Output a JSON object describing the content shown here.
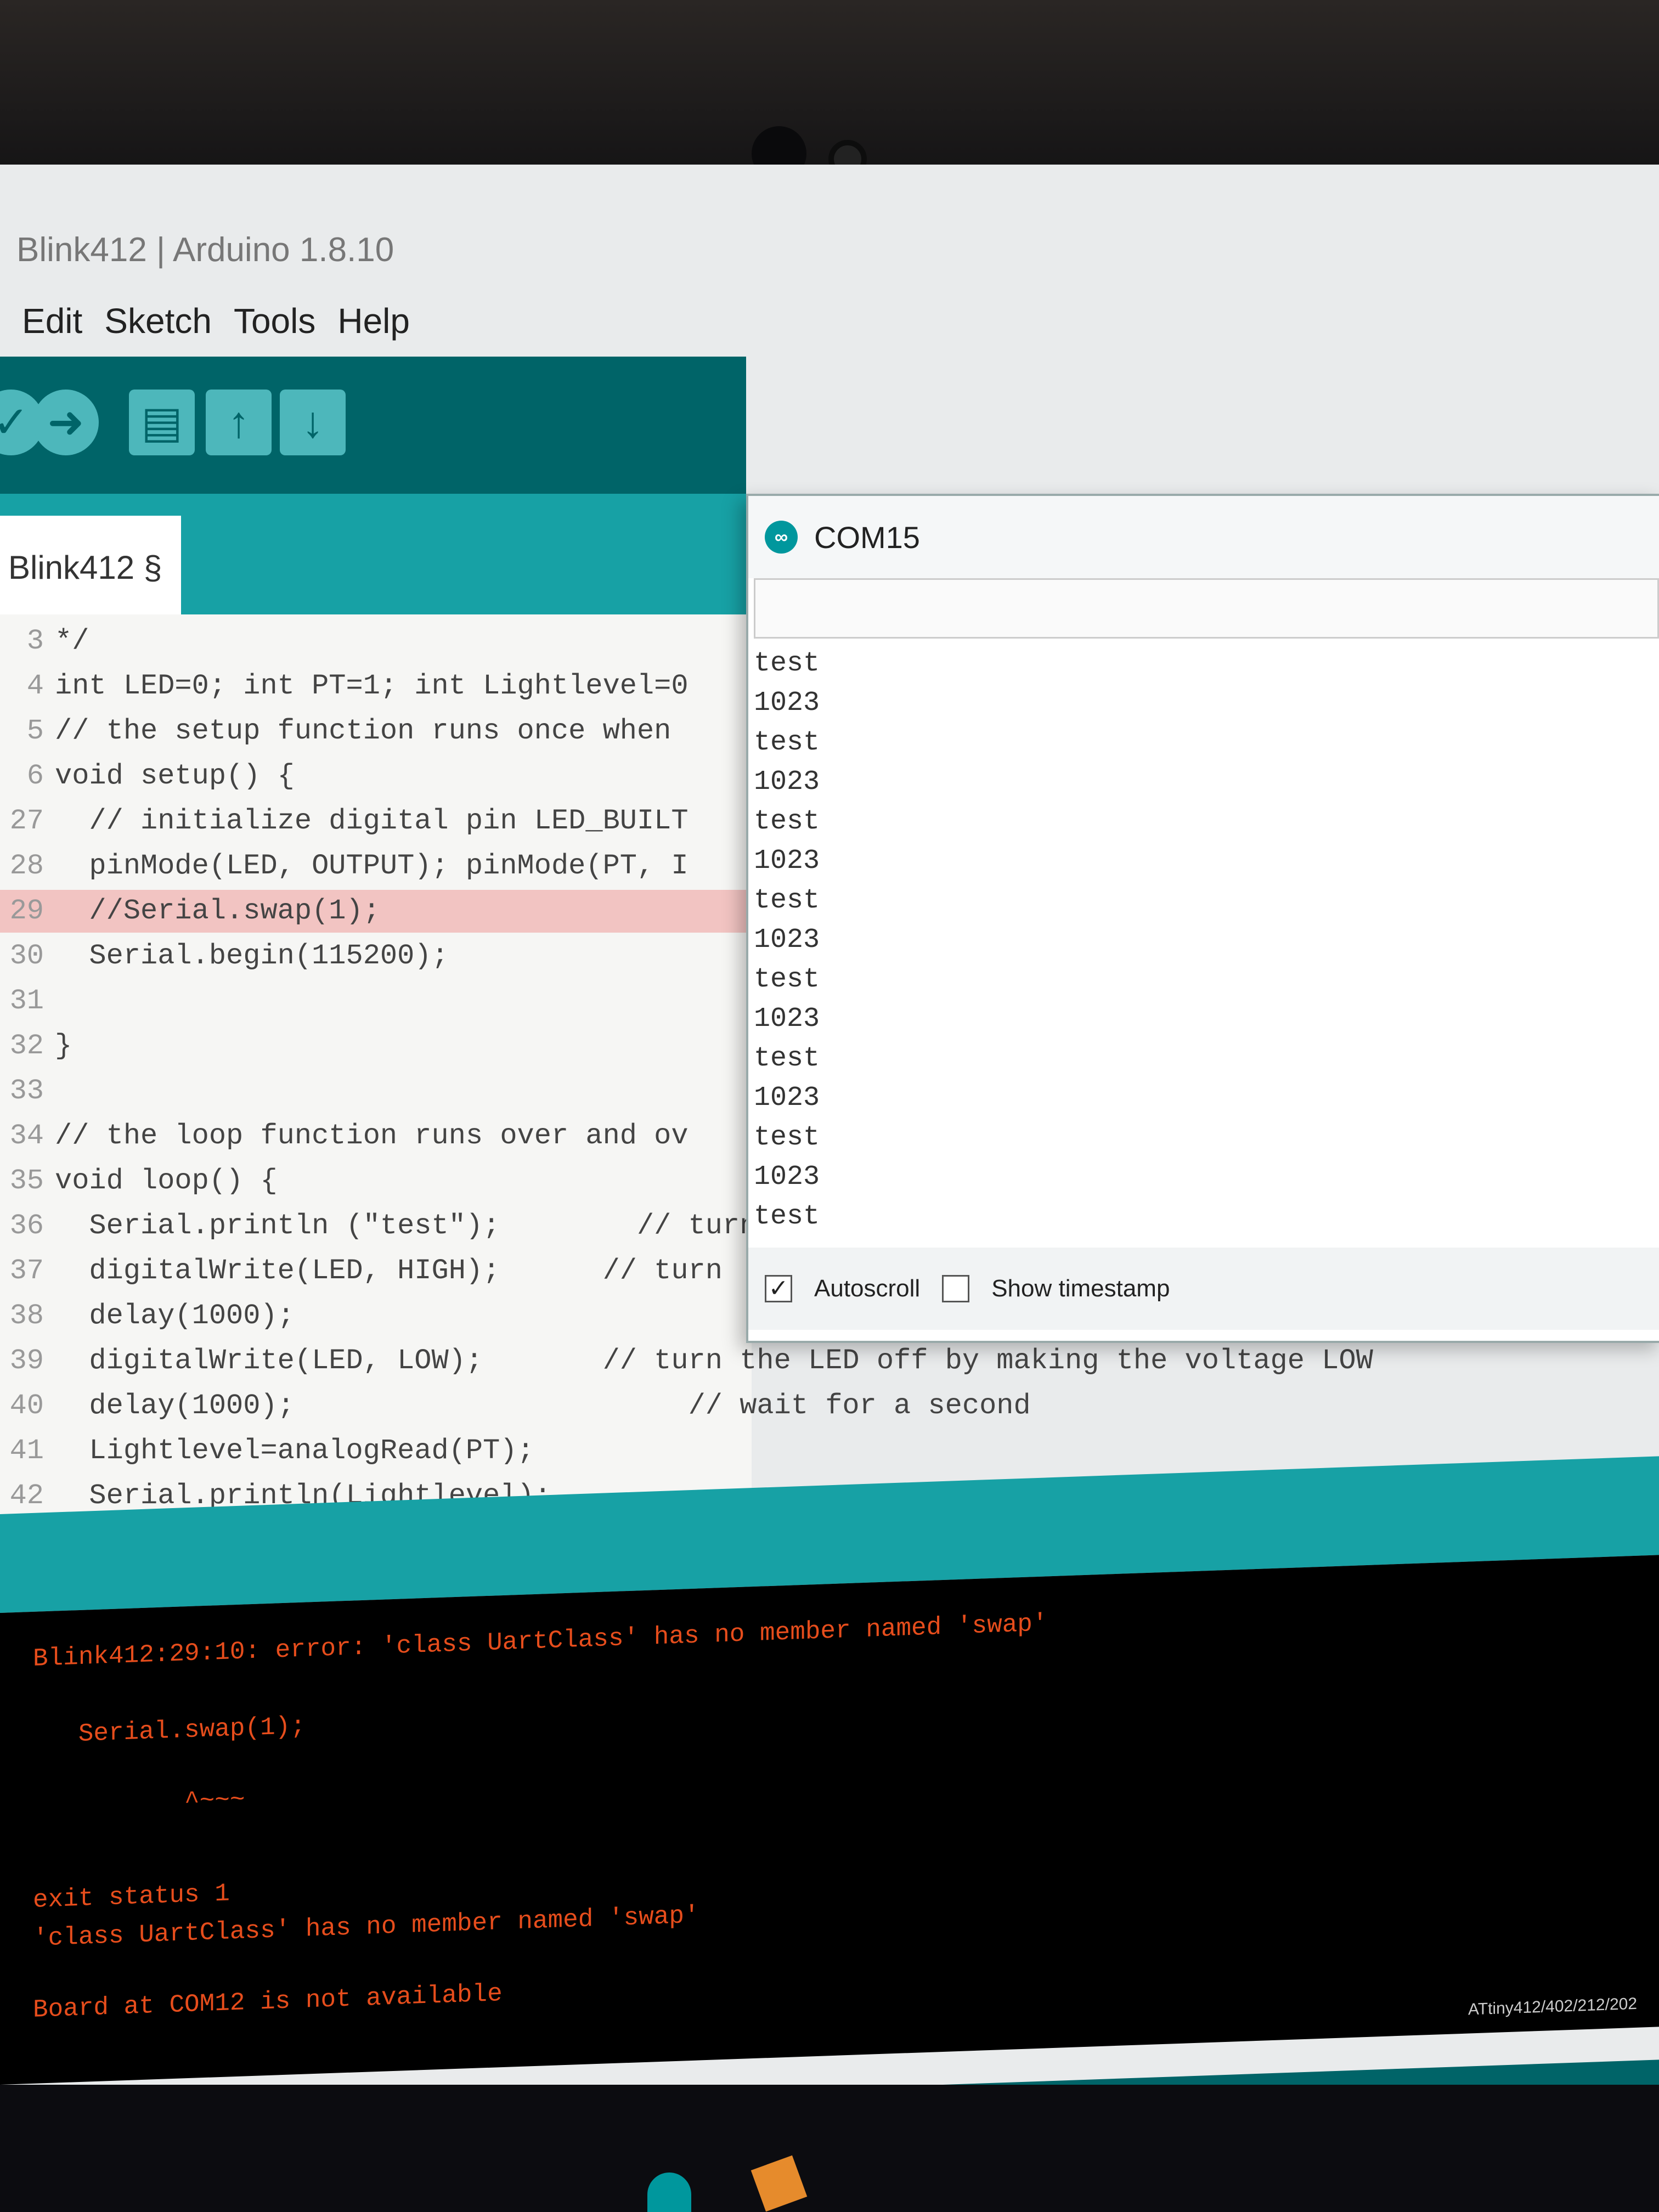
{
  "window": {
    "title": "Blink412 | Arduino 1.8.10"
  },
  "menu": [
    "Edit",
    "Sketch",
    "Tools",
    "Help"
  ],
  "toolbar": {
    "verify_icon": "check-icon",
    "upload_icon": "arrow-right-icon",
    "new_icon": "document-icon",
    "open_icon": "arrow-up-icon",
    "save_icon": "arrow-down-icon"
  },
  "tab": {
    "label": "Blink412 §"
  },
  "code": [
    {
      "ln": "3",
      "text": "*/"
    },
    {
      "ln": "4",
      "text": "int LED=0; int PT=1; int Lightlevel=0"
    },
    {
      "ln": "5",
      "text": "// the setup function runs once when"
    },
    {
      "ln": "6",
      "text": "void setup() {"
    },
    {
      "ln": "27",
      "text": "  // initialize digital pin LED_BUILT"
    },
    {
      "ln": "28",
      "text": "  pinMode(LED, OUTPUT); pinMode(PT, I"
    },
    {
      "ln": "29",
      "text": "  //Serial.swap(1);",
      "highlight": true
    },
    {
      "ln": "30",
      "text": "  Serial.begin(115200);"
    },
    {
      "ln": "31",
      "text": ""
    },
    {
      "ln": "32",
      "text": "}"
    },
    {
      "ln": "33",
      "text": ""
    },
    {
      "ln": "34",
      "text": "// the loop function runs over and ov"
    },
    {
      "ln": "35",
      "text": "void loop() {"
    },
    {
      "ln": "36",
      "text": "  Serial.println (\"test\");        // turn"
    },
    {
      "ln": "37",
      "text": "  digitalWrite(LED, HIGH);      // turn"
    },
    {
      "ln": "38",
      "text": "  delay(1000);"
    },
    {
      "ln": "39",
      "text": "  digitalWrite(LED, LOW);       // turn the LED off by making the voltage LOW"
    },
    {
      "ln": "40",
      "text": "  delay(1000);                       // wait for a second"
    },
    {
      "ln": "41",
      "text": "  Lightlevel=analogRead(PT);"
    },
    {
      "ln": "42",
      "text": "  Serial.println(Lightlevel);"
    }
  ],
  "console": [
    "Blink412:29:10: error: 'class UartClass' has no member named 'swap'",
    "   Serial.swap(1);",
    "          ^~~~",
    "exit status 1",
    "'class UartClass' has no member named 'swap'",
    "Board at COM12 is not available"
  ],
  "status": {
    "line": "29",
    "board": "ATtiny412/402/212/202"
  },
  "serial": {
    "title": "COM15",
    "logo": "∞",
    "lines": [
      "test",
      "1023",
      "test",
      "1023",
      "test",
      "1023",
      "test",
      "1023",
      "test",
      "1023",
      "test",
      "1023",
      "test",
      "1023",
      "test"
    ],
    "autoscroll_label": "Autoscroll",
    "autoscroll_mark": "✓",
    "timestamp_label": "Show timestamp"
  }
}
